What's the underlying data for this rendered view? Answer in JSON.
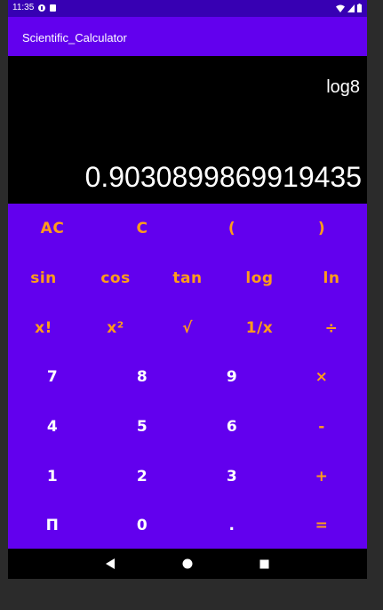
{
  "status_bar": {
    "time": "11:35"
  },
  "app_bar": {
    "title": "Scientific_Calculator"
  },
  "display": {
    "expression": "log8",
    "result": "0.9030899869919435"
  },
  "keypad": {
    "rows": [
      [
        {
          "label": "AC",
          "color": "orange"
        },
        {
          "label": "C",
          "color": "orange"
        },
        {
          "label": "(",
          "color": "orange"
        },
        {
          "label": ")",
          "color": "orange"
        }
      ],
      [
        {
          "label": "sin",
          "color": "orange"
        },
        {
          "label": "cos",
          "color": "orange"
        },
        {
          "label": "tan",
          "color": "orange"
        },
        {
          "label": "log",
          "color": "orange"
        },
        {
          "label": "ln",
          "color": "orange"
        }
      ],
      [
        {
          "label": "x!",
          "color": "orange"
        },
        {
          "label": "x²",
          "color": "orange"
        },
        {
          "label": "√",
          "color": "orange"
        },
        {
          "label": "1/x",
          "color": "orange"
        },
        {
          "label": "÷",
          "color": "orange"
        }
      ],
      [
        {
          "label": "7",
          "color": "white"
        },
        {
          "label": "8",
          "color": "white"
        },
        {
          "label": "9",
          "color": "white"
        },
        {
          "label": "×",
          "color": "orange"
        }
      ],
      [
        {
          "label": "4",
          "color": "white"
        },
        {
          "label": "5",
          "color": "white"
        },
        {
          "label": "6",
          "color": "white"
        },
        {
          "label": "-",
          "color": "orange"
        }
      ],
      [
        {
          "label": "1",
          "color": "white"
        },
        {
          "label": "2",
          "color": "white"
        },
        {
          "label": "3",
          "color": "white"
        },
        {
          "label": "+",
          "color": "orange"
        }
      ],
      [
        {
          "label": "Π",
          "color": "white"
        },
        {
          "label": "0",
          "color": "white"
        },
        {
          "label": ".",
          "color": "white"
        },
        {
          "label": "=",
          "color": "orange"
        }
      ]
    ]
  },
  "colors": {
    "status_bar": "#3700b3",
    "app_bar": "#6200ee",
    "keypad": "#6200ee",
    "accent_orange": "#ff9c1a",
    "text_white": "#ffffff",
    "display_bg": "#000000"
  },
  "nav_bar": {
    "icons": [
      "back-icon",
      "home-icon",
      "recents-icon"
    ]
  }
}
